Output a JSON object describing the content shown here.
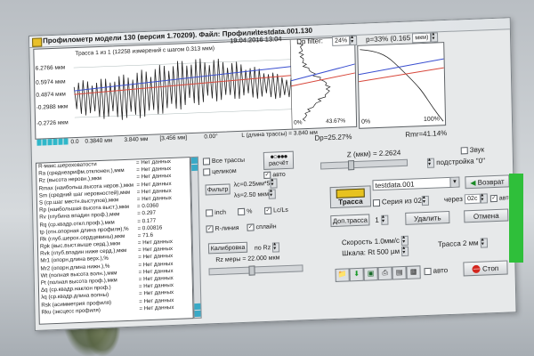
{
  "window": {
    "title": "Профилометр модели 130 (версия 1.70209). Файл: Профили\\testdata.001.130"
  },
  "plot": {
    "trace_info": "Трасса 1 из 1 (12258 измерений с шагом 0.313 мкм)",
    "datetime": "19.04.2016 13:04",
    "y_labels": [
      "6.2766 мкм",
      "0.5974 мкм",
      "0.4874 мкм",
      "-0.2988 мкм",
      "-0.2726 мкм"
    ],
    "x_labels": [
      "0.0",
      "0.3840 мм",
      "3.840 мм",
      "[3.456 мм]",
      "0.00°"
    ],
    "length_label": "L (длина трассы) = 3.840 мм",
    "dp_filter_label": "Dp filter:",
    "dp_filter_value": "24%",
    "p_label": "p=33% (0.165",
    "p_unit": "мкм)",
    "hist_min": "0%",
    "hist_pct": "43.67%",
    "hist_min2": "0%",
    "curve_max": "100%",
    "dp_value": "Dp=25.27%",
    "rmr_value": "Rmr=41.14%"
  },
  "params": [
    {
      "name": "R-макс.шероховатости",
      "value": "= Нет данных"
    },
    {
      "name": "Ra (среднеарифм.отклонен.),мкм",
      "value": "= Нет данных"
    },
    {
      "name": "Rz (высота неровн.),мкм",
      "value": "= Нет данных"
    },
    {
      "name": "Rmax (наибольш.высота неров.),мкм",
      "value": "= Нет данных"
    },
    {
      "name": "Sm (средний шаг неровностей),мкм",
      "value": "= Нет данных"
    },
    {
      "name": "S (ср.шаг местн.выступов),мкм",
      "value": "= Нет данных"
    },
    {
      "name": "Rp (наибольшая высота выст.),мкм",
      "value": "= 0.0360"
    },
    {
      "name": "Rv (глубина впадин проф.),мкм",
      "value": "= 0.297"
    },
    {
      "name": "Rq (ср.квадр.откл.проф.),мкм",
      "value": "= 0.177"
    },
    {
      "name": "tp (отн.опорная длина профиля),%",
      "value": "= 0.00816"
    },
    {
      "name": "Rk (глуб.шерох.сердцевины),мкм",
      "value": "= 71.6"
    },
    {
      "name": "Rpk (выс.выст.выше серд.),мкм",
      "value": "= Нет данных"
    },
    {
      "name": "Rvk (глуб.впадин ниже серд.),мкм",
      "value": "= Нет данных"
    },
    {
      "name": "Mr1 (опорн.длина верх.),%",
      "value": "= Нет данных"
    },
    {
      "name": "Mr2 (опорн.длина нижн.),%",
      "value": "= Нет данных"
    },
    {
      "name": "Wt (полная высота волн.),мкм",
      "value": "= Нет данных"
    },
    {
      "name": "Pt (полная высота проф.),мкм",
      "value": "= Нет данных"
    },
    {
      "name": "Δq (ср.квадр.наклон проф.)",
      "value": "= Нет данных"
    },
    {
      "name": "λq (ср.квадр.длина волны)",
      "value": "= Нет данных"
    },
    {
      "name": "Rsk (асимметрия профиля)",
      "value": "= Нет данных"
    },
    {
      "name": "Rku (эксцесс профиля)",
      "value": "= Нет данных"
    }
  ],
  "mid": {
    "all_traces": "Все трассы",
    "whole": "целиком",
    "calc_button": "расчёт",
    "auto": "авто",
    "filter_button": "Фильтр",
    "lambda_c": "λc=0.25мм",
    "lambda_c_x": "*5",
    "lambda_s": "λs=2.50 мкм",
    "inch": "inch",
    "percent": "%",
    "lc_ls": "Lc/Ls",
    "r_line": "R-линия",
    "spline": "сплайн",
    "calib_button": "Калибровка",
    "by_rz": "по Rz",
    "rz_label": "Rz меры = 22.000 мкм"
  },
  "right": {
    "z_label": "Z (мкм) = 2.2624",
    "sound": "Звук",
    "tuning": "подстройка \"0\"",
    "trassa_label": "Трасса",
    "file_value": "testdata.001",
    "return_button": "Возврат",
    "series_label": "Серия из",
    "series_value": "02",
    "every_label": "через",
    "every_value": "02с",
    "auto_label": "авто",
    "add_trace_button": "Доп.трасса",
    "add_trace_count": "1",
    "delete_button": "Удалить",
    "cancel_button": "Отмена",
    "speed_label": "Скорость 1.0мм/с",
    "scale_label": "Шкала: Rt 500 µм",
    "trace_mm": "Трасса 2 мм",
    "auto2": "авто",
    "stop_button": "Стоп"
  },
  "colors": {
    "accent_green": "#2fbf3a",
    "trace_red": "#d8483c",
    "trace_blue": "#3a4fd0",
    "stop_red": "#d3261e",
    "car_yellow": "#e7c21f"
  }
}
